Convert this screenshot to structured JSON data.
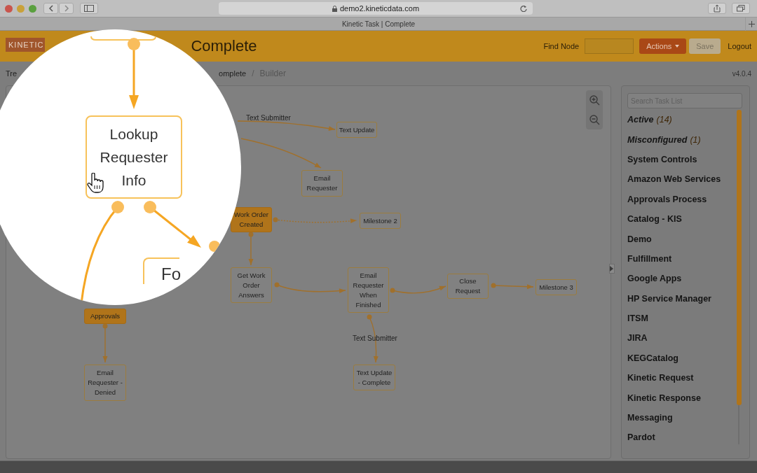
{
  "browser": {
    "address": "demo2.kineticdata.com",
    "tab_title": "Kinetic Task | Complete"
  },
  "header": {
    "logo": "KINETIC",
    "title": "Complete",
    "find_node": {
      "label": "Find Node"
    },
    "buttons": [
      {
        "label": "Actions",
        "kind": "dropdown"
      },
      {
        "label": "Save",
        "kind": "plain"
      },
      {
        "label": "Logout",
        "kind": "link"
      }
    ]
  },
  "breadcrumb": {
    "items": [
      "Tre",
      "omplete",
      "Builder"
    ],
    "separator": "/",
    "version": "v4.0.4"
  },
  "canvas": {
    "nodes": [
      {
        "label": "Text Update",
        "kind": "task"
      },
      {
        "label": "Email Requester",
        "kind": "task"
      },
      {
        "label": "Work Order Created",
        "kind": "group"
      },
      {
        "label": "Milestone 2",
        "kind": "task"
      },
      {
        "label": "Get Work Order Answers",
        "kind": "task"
      },
      {
        "label": "Email Requester When Finished",
        "kind": "task"
      },
      {
        "label": "Close Request",
        "kind": "task"
      },
      {
        "label": "Milestone 3",
        "kind": "task"
      },
      {
        "label": "Approvals",
        "kind": "group"
      },
      {
        "label": "Email Requester - Denied",
        "kind": "task"
      },
      {
        "label": "Text Update - Complete",
        "kind": "task"
      }
    ],
    "edge_labels": [
      "Text Submitter",
      "Text Submitter"
    ]
  },
  "magnifier": {
    "node": "Lookup Requester Info",
    "partial_node": "Fo"
  },
  "task_list": {
    "search": {
      "placeholder": "Search Task List"
    },
    "items": [
      {
        "label": "Active",
        "count": "(14)",
        "kind": "filter"
      },
      {
        "label": "Misconfigured",
        "count": "(1)",
        "kind": "filter"
      },
      {
        "label": "System Controls",
        "kind": "category"
      },
      {
        "label": "Amazon Web Services",
        "kind": "category"
      },
      {
        "label": "Approvals Process",
        "kind": "category"
      },
      {
        "label": "Catalog - KIS",
        "kind": "category"
      },
      {
        "label": "Demo",
        "kind": "category"
      },
      {
        "label": "Fulfillment",
        "kind": "category"
      },
      {
        "label": "Google Apps",
        "kind": "category"
      },
      {
        "label": "HP Service Manager",
        "kind": "category"
      },
      {
        "label": "ITSM",
        "kind": "category"
      },
      {
        "label": "JIRA",
        "kind": "category"
      },
      {
        "label": "KEGCatalog",
        "kind": "category"
      },
      {
        "label": "Kinetic Request",
        "kind": "category"
      },
      {
        "label": "Kinetic Response",
        "kind": "category"
      },
      {
        "label": "Messaging",
        "kind": "category"
      },
      {
        "label": "Pardot",
        "kind": "category"
      }
    ]
  }
}
